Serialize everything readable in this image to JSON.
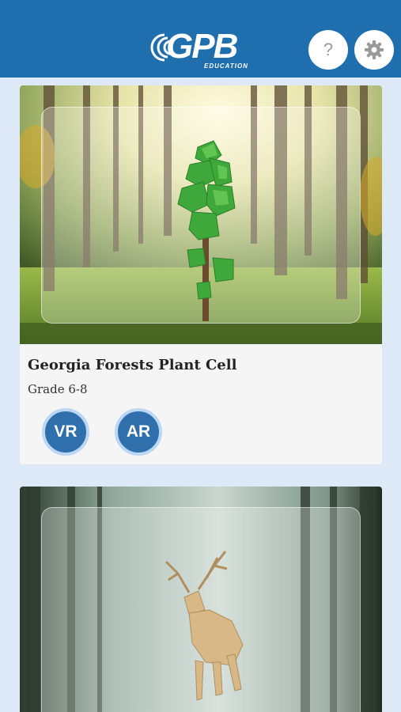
{
  "header": {
    "logo_text": "GPB",
    "logo_subtext": "EDUCATION",
    "help_label": "?",
    "help_icon": "question-mark-icon",
    "settings_icon": "gear-icon",
    "background_color": "#1f6faf"
  },
  "cards": [
    {
      "title": "Georgia Forests Plant Cell",
      "grade": "Grade 6-8",
      "buttons": [
        {
          "label": "VR"
        },
        {
          "label": "AR"
        }
      ],
      "image": "sunlit forest with low-poly tree model"
    },
    {
      "image": "misty forest with low-poly deer model"
    }
  ],
  "colors": {
    "page_background": "#dde9f7",
    "button_blue": "#2f6fac"
  }
}
